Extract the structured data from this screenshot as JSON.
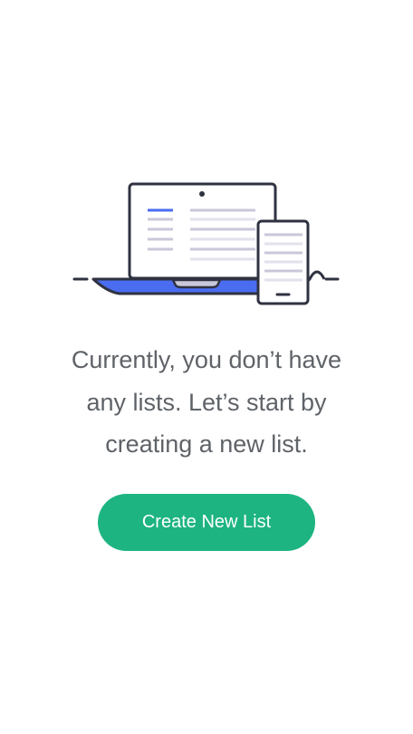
{
  "empty_state": {
    "message_lines": [
      "Currently, you don’t have",
      "any lists. Let’s start by",
      "creating a new list."
    ],
    "create_button_label": "Create New List"
  },
  "colors": {
    "accent_green": "#1db482",
    "accent_blue": "#4a6cf0",
    "text_gray": "#5f6368",
    "outline": "#2f3240",
    "line_gray": "#c9c8da"
  },
  "icons": [
    "laptop-icon",
    "phone-icon"
  ]
}
